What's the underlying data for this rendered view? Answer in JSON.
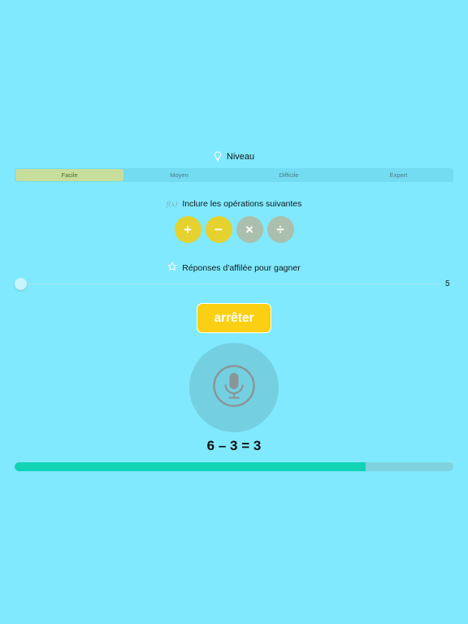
{
  "level": {
    "icon": "lightbulb-icon",
    "title": "Niveau",
    "options": [
      "Facile",
      "Moyen",
      "Difficile",
      "Expert"
    ],
    "selected_index": 0
  },
  "operations": {
    "icon": "function-icon",
    "icon_text": "f(x)",
    "title": "Inclure les opérations suivantes",
    "items": [
      {
        "symbol": "+",
        "enabled": true
      },
      {
        "symbol": "−",
        "enabled": true
      },
      {
        "symbol": "×",
        "enabled": false
      },
      {
        "symbol": "÷",
        "enabled": false
      }
    ]
  },
  "streak": {
    "icon": "star-icon",
    "title": "Réponses d'affilée pour gagner",
    "value": "5"
  },
  "stop_button": {
    "label": "arrêter"
  },
  "mic": {
    "icon": "microphone-icon"
  },
  "equation": "6 – 3 = 3",
  "progress": {
    "fraction": 0.8
  },
  "colors": {
    "background": "#80e9fe",
    "accent_yellow": "#fbd012",
    "op_enabled": "#e6d22e",
    "op_disabled": "#aabfad",
    "progress": "#11d4b4",
    "selected_segment": "#c6dd9c"
  }
}
